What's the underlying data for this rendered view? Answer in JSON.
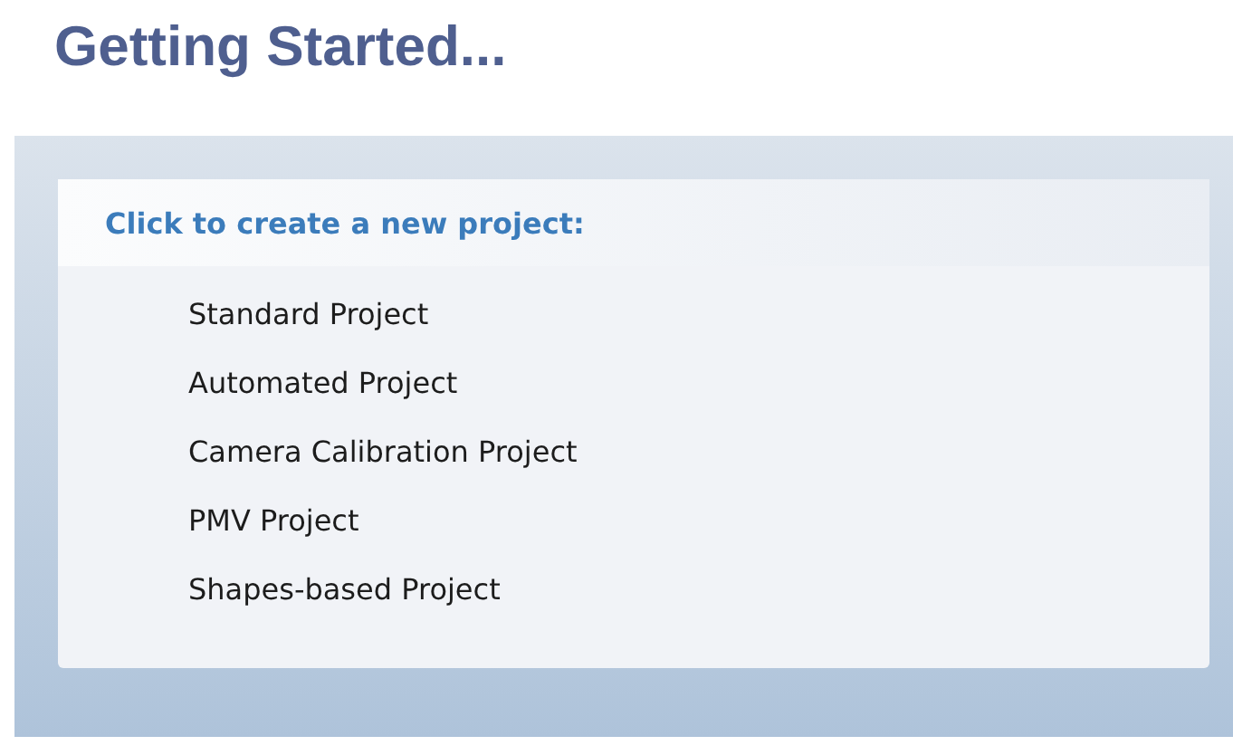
{
  "title": "Getting Started...",
  "panel": {
    "heading": "Click to create a new project:",
    "items": [
      "Standard Project",
      "Automated Project",
      "Camera Calibration Project",
      "PMV Project",
      "Shapes-based Project"
    ]
  }
}
